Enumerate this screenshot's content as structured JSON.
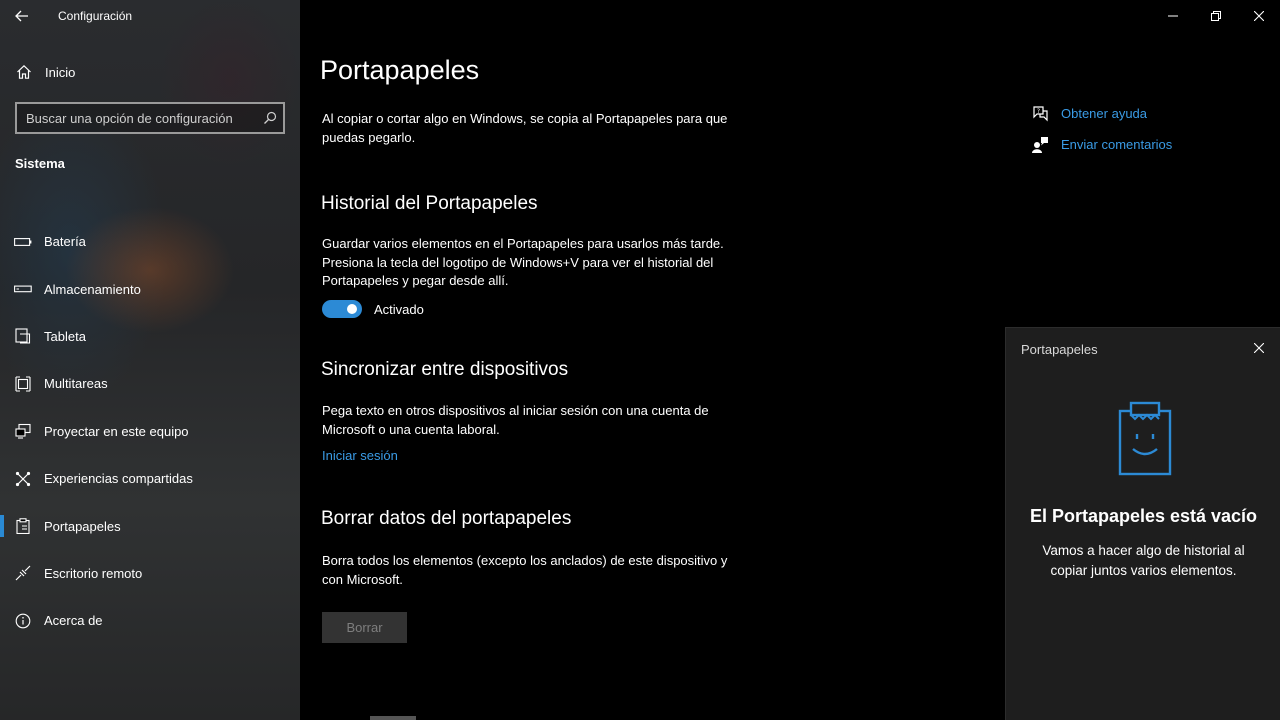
{
  "window": {
    "app_title": "Configuración"
  },
  "sidebar": {
    "home_label": "Inicio",
    "search": {
      "placeholder": "Buscar una opción de configuración",
      "value": ""
    },
    "section": "Sistema",
    "items": [
      {
        "label": "Batería",
        "icon": "battery-icon"
      },
      {
        "label": "Almacenamiento",
        "icon": "storage-icon"
      },
      {
        "label": "Tableta",
        "icon": "tablet-icon"
      },
      {
        "label": "Multitareas",
        "icon": "multitasking-icon"
      },
      {
        "label": "Proyectar en este equipo",
        "icon": "project-icon"
      },
      {
        "label": "Experiencias compartidas",
        "icon": "shared-experiences-icon"
      },
      {
        "label": "Portapapeles",
        "icon": "clipboard-icon",
        "selected": true
      },
      {
        "label": "Escritorio remoto",
        "icon": "remote-desktop-icon"
      },
      {
        "label": "Acerca de",
        "icon": "info-icon"
      }
    ]
  },
  "main": {
    "title": "Portapapeles",
    "intro": "Al copiar o cortar algo en Windows, se copia al Portapapeles para que puedas pegarlo.",
    "history": {
      "heading": "Historial del Portapapeles",
      "description": "Guardar varios elementos en el Portapapeles para usarlos más tarde. Presiona la tecla del logotipo de Windows+V para ver el historial del Portapapeles y pegar desde allí.",
      "toggle_label": "Activado",
      "toggle_on": true
    },
    "sync": {
      "heading": "Sincronizar entre dispositivos",
      "description": "Pega texto en otros dispositivos al iniciar sesión con una cuenta de Microsoft o una cuenta laboral.",
      "link": "Iniciar sesión"
    },
    "clear": {
      "heading": "Borrar datos del portapapeles",
      "description": "Borra todos los elementos (excepto los anclados) de este dispositivo y con Microsoft.",
      "button": "Borrar"
    },
    "help": {
      "get_help": "Obtener ayuda",
      "feedback": "Enviar comentarios"
    }
  },
  "flyout": {
    "title": "Portapapeles",
    "heading": "El Portapapeles está vacío",
    "text": "Vamos a hacer algo de historial al copiar juntos varios elementos."
  },
  "colors": {
    "accent": "#2c8ad5",
    "link": "#3a9be5",
    "main_bg": "#000000",
    "flyout_bg": "#1e1e1e"
  }
}
